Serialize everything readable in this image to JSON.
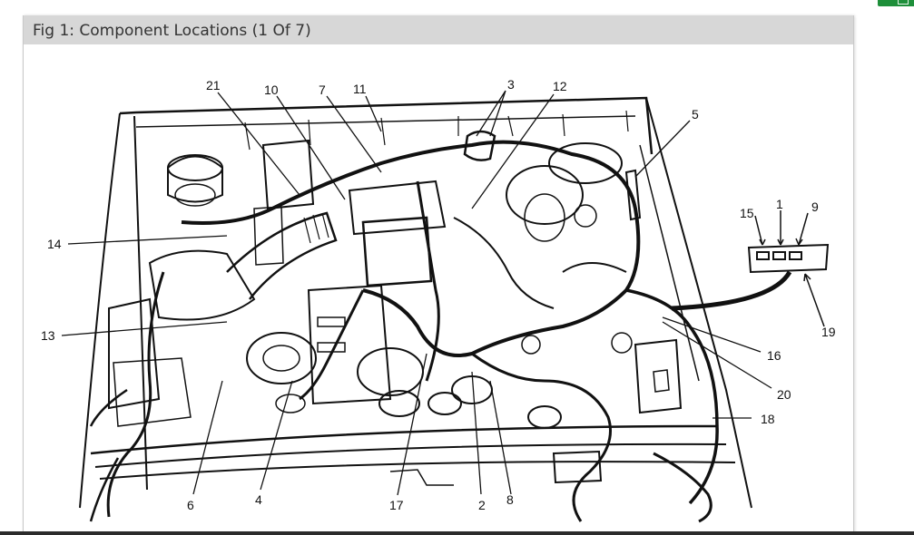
{
  "figure": {
    "title": "Fig 1: Component Locations (1 Of 7)"
  },
  "callouts": [
    "21",
    "10",
    "7",
    "11",
    "3",
    "12",
    "5",
    "15",
    "1",
    "9",
    "14",
    "13",
    "19",
    "16",
    "20",
    "18",
    "6",
    "4",
    "17",
    "2",
    "8"
  ]
}
